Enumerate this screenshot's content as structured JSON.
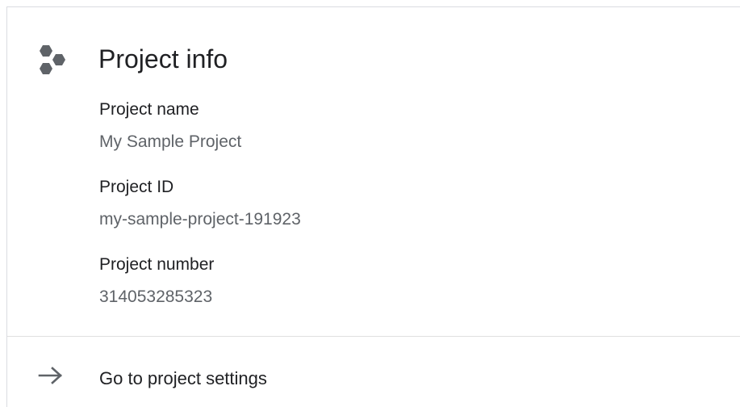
{
  "card": {
    "title": "Project info",
    "icon": "hexagon-cluster-icon",
    "fields": [
      {
        "label": "Project name",
        "value": "My Sample Project"
      },
      {
        "label": "Project ID",
        "value": "my-sample-project-191923"
      },
      {
        "label": "Project number",
        "value": "314053285323"
      }
    ],
    "settings_link": {
      "icon": "arrow-right-icon",
      "label": "Go to project settings"
    }
  },
  "colors": {
    "title_text": "#202124",
    "value_text": "#5f6368",
    "icon": "#5f6368",
    "divider": "#e0e0e0"
  }
}
